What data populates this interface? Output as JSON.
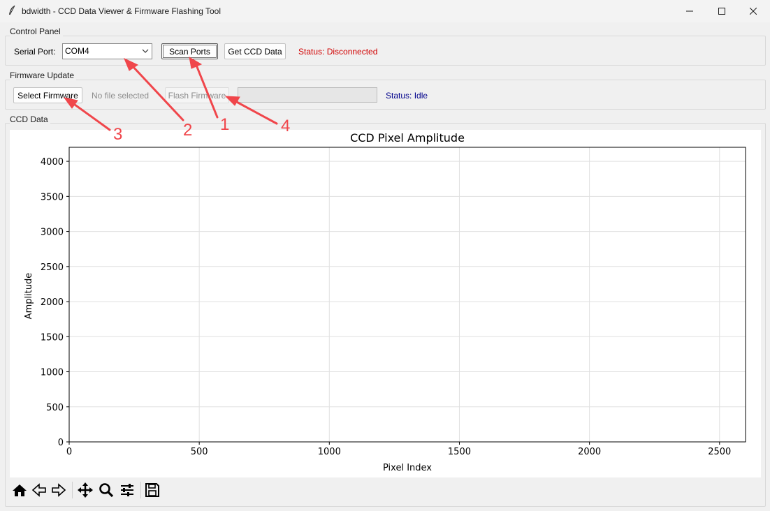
{
  "window": {
    "title": "bdwidth - CCD Data Viewer & Firmware Flashing Tool"
  },
  "control_panel": {
    "group_label": "Control Panel",
    "serial_port_label": "Serial Port:",
    "serial_port_value": "COM4",
    "scan_ports_label": "Scan Ports",
    "get_ccd_label": "Get CCD Data",
    "status_text": "Status: Disconnected"
  },
  "firmware": {
    "group_label": "Firmware Update",
    "select_label": "Select Firmware",
    "file_text": "No file selected",
    "flash_label": "Flash Firmware",
    "progress": 0,
    "status_text": "Status: Idle"
  },
  "ccd": {
    "group_label": "CCD Data"
  },
  "chart_data": {
    "type": "line",
    "title": "CCD Pixel Amplitude",
    "xlabel": "Pixel Index",
    "ylabel": "Amplitude",
    "xlim": [
      0,
      2600
    ],
    "ylim": [
      0,
      4200
    ],
    "xticks": [
      0,
      500,
      1000,
      1500,
      2000,
      2500
    ],
    "yticks": [
      0,
      500,
      1000,
      1500,
      2000,
      2500,
      3000,
      3500,
      4000
    ],
    "grid": true,
    "series": []
  },
  "toolbar": {
    "icons": [
      "home-icon",
      "back-icon",
      "forward-icon",
      "pan-icon",
      "zoom-icon",
      "configure-subplots-icon",
      "save-icon"
    ]
  },
  "annotations": {
    "labels": [
      "1",
      "2",
      "3",
      "4"
    ],
    "color": "#f0464b"
  },
  "colors": {
    "status_disconnected": "#d10000",
    "status_idle": "#00008b"
  }
}
